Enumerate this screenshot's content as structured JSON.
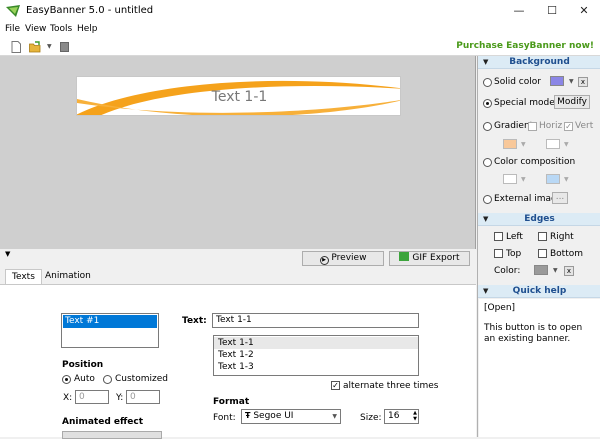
{
  "window": {
    "title": "EasyBanner 5.0 - untitled",
    "minimize": "—",
    "maximize": "☐",
    "close": "✕"
  },
  "menu": [
    "File",
    "View",
    "Tools",
    "Help"
  ],
  "toolbar": {
    "purchase_label": "Purchase EasyBanner now!"
  },
  "banner": {
    "text": "Text 1-1",
    "accent_color": "#f5a21b"
  },
  "preview_buttons": {
    "preview": "Preview",
    "gif_export": "GIF Export"
  },
  "tabs": [
    "Texts",
    "Animation"
  ],
  "texts_tab": {
    "text_items": [
      "Text #1"
    ],
    "position_label": "Position",
    "position_auto": "Auto",
    "position_customized": "Customized",
    "x_label": "X:",
    "x_value": "0",
    "y_label": "Y:",
    "y_value": "0",
    "animated_effect_label": "Animated effect",
    "text_label": "Text:",
    "text_value": "Text 1-1",
    "text_lines": [
      "Text 1-1",
      "Text 1-2",
      "Text 1-3"
    ],
    "alternate_label": "alternate three times",
    "format_label": "Format",
    "font_label": "Font:",
    "font_value": "Segoe UI",
    "size_label": "Size:",
    "size_value": "16"
  },
  "background": {
    "title": "Background",
    "solid_color": "Solid color",
    "solid_swatch": "#8b86e6",
    "special_model": "Special model",
    "modify": "Modify",
    "gradient": "Gradient",
    "horiz": "Horiz",
    "vert": "Vert",
    "gradient_swatch_1": "#f8c89a",
    "gradient_swatch_2": "#ffffff",
    "color_composition": "Color composition",
    "comp_swatch_1": "#ffffff",
    "comp_swatch_2": "#b9d8f5",
    "external_image": "External image",
    "browse": "...",
    "clear": "x"
  },
  "edges": {
    "title": "Edges",
    "left": "Left",
    "right": "Right",
    "top": "Top",
    "bottom": "Bottom",
    "color_label": "Color:",
    "color_swatch": "#9a9a9a",
    "clear": "x"
  },
  "quick_help": {
    "title": "Quick help",
    "heading": "[Open]",
    "body": "This button is to open an existing banner."
  }
}
